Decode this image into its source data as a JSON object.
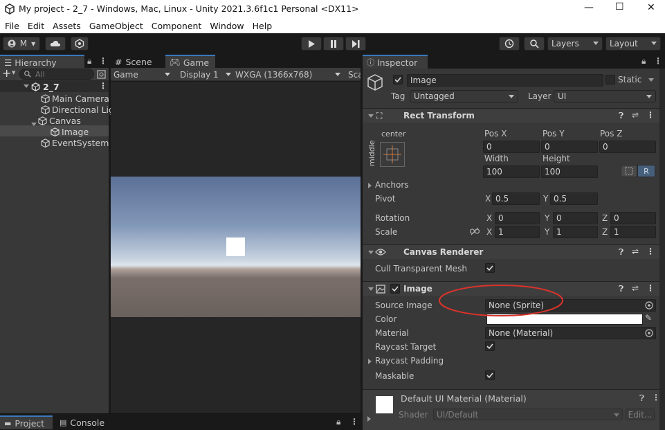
{
  "window": {
    "title": "My project - 2_7 - Windows, Mac, Linux - Unity 2021.3.6f1c1 Personal <DX11>",
    "controls": [
      "—",
      "☐",
      "✕"
    ]
  },
  "menu": [
    "File",
    "Edit",
    "Assets",
    "GameObject",
    "Component",
    "Window",
    "Help"
  ],
  "toolbar": {
    "account_label": "M",
    "layers_label": "Layers",
    "layout_label": "Layout"
  },
  "hierarchy": {
    "tab_label": "Hierarchy",
    "search_placeholder": "All",
    "scene_name": "2_7",
    "items": [
      {
        "label": "Main Camera"
      },
      {
        "label": "Directional Lig"
      },
      {
        "label": "Canvas"
      },
      {
        "label": "Image"
      },
      {
        "label": "EventSystem"
      }
    ]
  },
  "scene_tabs": {
    "scene": "Scene",
    "game": "Game"
  },
  "game_bar": {
    "mode": "Game",
    "display": "Display 1",
    "resolution": "WXGA (1366x768)",
    "scale_cut": "Sca"
  },
  "bottom_tabs": {
    "project": "Project",
    "console": "Console"
  },
  "inspector": {
    "tab_label": "Inspector",
    "object_name": "Image",
    "static_label": "Static",
    "tag_label": "Tag",
    "tag_value": "Untagged",
    "layer_label": "Layer",
    "layer_value": "UI",
    "rect_transform": {
      "title": "Rect Transform",
      "anchor_h": "center",
      "anchor_v": "middle",
      "posx_label": "Pos X",
      "posx": "0",
      "posy_label": "Pos Y",
      "posy": "0",
      "posz_label": "Pos Z",
      "posz": "0",
      "width_label": "Width",
      "width": "100",
      "height_label": "Height",
      "height": "100",
      "r_button": "R",
      "anchors_label": "Anchors",
      "pivot_label": "Pivot",
      "pivot_x": "0.5",
      "pivot_y": "0.5",
      "rotation_label": "Rotation",
      "rot_x": "0",
      "rot_y": "0",
      "rot_z": "0",
      "scale_label": "Scale",
      "scale_x": "1",
      "scale_y": "1",
      "scale_z": "1",
      "x": "X",
      "y": "Y",
      "z": "Z"
    },
    "canvas_renderer": {
      "title": "Canvas Renderer",
      "cull_label": "Cull Transparent Mesh",
      "cull_checked": true
    },
    "image": {
      "title": "Image",
      "source_label": "Source Image",
      "source_value": "None (Sprite)",
      "color_label": "Color",
      "color_value": "#ffffff",
      "material_label": "Material",
      "material_value": "None (Material)",
      "raycast_target_label": "Raycast Target",
      "raycast_padding_label": "Raycast Padding",
      "maskable_label": "Maskable"
    },
    "material": {
      "title": "Default UI Material (Material)",
      "shader_label": "Shader",
      "shader_value": "UI/Default",
      "edit_label": "Edit..."
    }
  },
  "colors": {
    "accent": "#3a79bb",
    "annotation": "#d9332b",
    "sky_top": "#5b7096",
    "horizon": "#dfe5ec",
    "ground": "#6a605c"
  }
}
